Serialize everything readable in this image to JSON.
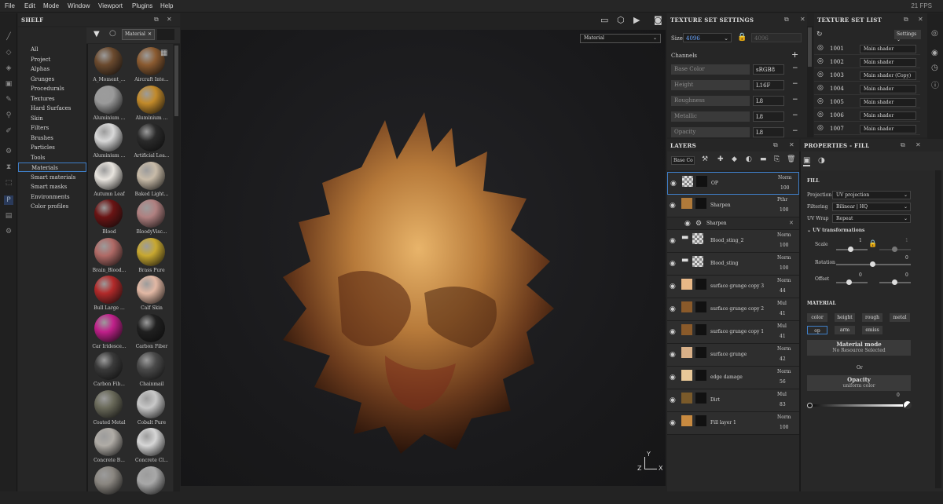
{
  "menu": {
    "file": "File",
    "edit": "Edit",
    "mode": "Mode",
    "window": "Window",
    "viewport": "Viewport",
    "plugins": "Plugins",
    "help": "Help",
    "fps": "21 FPS"
  },
  "shelf": {
    "title": "SHELF",
    "search_value": "Material",
    "categories": [
      "All",
      "Project",
      "Alphas",
      "Grunges",
      "Procedurals",
      "Textures",
      "Hard Surfaces",
      "Skin",
      "Filters",
      "Brushes",
      "Particles",
      "Tools",
      "Materials",
      "Smart materials",
      "Smart masks",
      "Environments",
      "Color profiles"
    ],
    "items": [
      {
        "label": "A_Moment_...",
        "color": "#6b4a2e"
      },
      {
        "label": "Aircraft Inte...",
        "color": "#8a5a30"
      },
      {
        "label": "Aluminium ...",
        "color": "#9a9a9a"
      },
      {
        "label": "Aluminium ...",
        "color": "#c28a2a"
      },
      {
        "label": "Aluminium ...",
        "color": "#d8d8d8"
      },
      {
        "label": "Artificial Lea...",
        "color": "#2a2a2a"
      },
      {
        "label": "Autumn Leaf",
        "color": "#e8e4de"
      },
      {
        "label": "Baked Light...",
        "color": "#c8bba8"
      },
      {
        "label": "Blood",
        "color": "#6a1414"
      },
      {
        "label": "BloodyVisc...",
        "color": "#b08080"
      },
      {
        "label": "Brain_Blood...",
        "color": "#b06a66"
      },
      {
        "label": "Brass Pure",
        "color": "#c8a830"
      },
      {
        "label": "Bull Large ...",
        "color": "#b22a2a"
      },
      {
        "label": "Calf Skin",
        "color": "#e2b8a4"
      },
      {
        "label": "Car Iridesce...",
        "color": "#c0208a"
      },
      {
        "label": "Carbon Fiber",
        "color": "#202020"
      },
      {
        "label": "Carbon Fib...",
        "color": "#3a3a3a"
      },
      {
        "label": "Chainmail",
        "color": "#4a4a4a"
      },
      {
        "label": "Coated Metal",
        "color": "#6a6a5a"
      },
      {
        "label": "Cobalt Pure",
        "color": "#c8c8c8"
      },
      {
        "label": "Concrete B...",
        "color": "#b0aca6"
      },
      {
        "label": "Concrete Cl...",
        "color": "#d6d6d6"
      },
      {
        "label": "",
        "color": "#8a8680"
      },
      {
        "label": "",
        "color": "#a8a8a8"
      }
    ]
  },
  "viewport": {
    "channel_select": "Material",
    "axis_x": "X",
    "axis_y": "Y",
    "axis_z": "Z"
  },
  "texture_set_settings": {
    "title": "TEXTURE SET SETTINGS",
    "size_label": "Size",
    "size_value": "4096",
    "size_value2": "4096",
    "channels_label": "Channels",
    "channels": [
      {
        "name": "Base Color",
        "format": "sRGB8"
      },
      {
        "name": "Height",
        "format": "L16F"
      },
      {
        "name": "Roughness",
        "format": "L8"
      },
      {
        "name": "Metallic",
        "format": "L8"
      },
      {
        "name": "Opacity",
        "format": "L8"
      }
    ]
  },
  "texture_set_list": {
    "title": "TEXTURE SET LIST",
    "settings_label": "Settings",
    "rows": [
      {
        "id": "1001",
        "shader": "Main shader"
      },
      {
        "id": "1002",
        "shader": "Main shader"
      },
      {
        "id": "1003",
        "shader": "Main shader (Copy)"
      },
      {
        "id": "1004",
        "shader": "Main shader"
      },
      {
        "id": "1005",
        "shader": "Main shader"
      },
      {
        "id": "1006",
        "shader": "Main shader"
      },
      {
        "id": "1007",
        "shader": "Main shader"
      }
    ]
  },
  "layers": {
    "title": "LAYERS",
    "channel": "Base Co",
    "rows": [
      {
        "name": "OP",
        "blend": "Norm",
        "opacity": "100",
        "thumb": "#cfcfcf"
      },
      {
        "name": "Sharpen",
        "blend": "Pthr",
        "opacity": "100",
        "thumb": "#b07a3a"
      },
      {
        "name": "Sharpen",
        "blend": "",
        "opacity": "",
        "thumb": ""
      },
      {
        "name": "Blood_sting_2",
        "blend": "Norm",
        "opacity": "100",
        "thumb": "#cfcfcf"
      },
      {
        "name": "Blood_sting",
        "blend": "Norm",
        "opacity": "100",
        "thumb": "#cfcfcf"
      },
      {
        "name": "surface grunge copy 3",
        "blend": "Norm",
        "opacity": "44",
        "thumb": "#e8b887"
      },
      {
        "name": "surface grunge copy 2",
        "blend": "Mul",
        "opacity": "41",
        "thumb": "#8a5a2a"
      },
      {
        "name": "surface grunge copy 1",
        "blend": "Mul",
        "opacity": "41",
        "thumb": "#8a5a2a"
      },
      {
        "name": "surface grunge",
        "blend": "Norm",
        "opacity": "42",
        "thumb": "#d8b088"
      },
      {
        "name": "edge damage",
        "blend": "Norm",
        "opacity": "56",
        "thumb": "#e8c898"
      },
      {
        "name": "Dirt",
        "blend": "Mul",
        "opacity": "83",
        "thumb": "#7a5a2a"
      },
      {
        "name": "Fill layer 1",
        "blend": "Norm",
        "opacity": "100",
        "thumb": "#c88a40"
      }
    ]
  },
  "properties": {
    "title": "PROPERTIES - FILL",
    "fill_label": "FILL",
    "projection_label": "Projection",
    "projection_value": "UV projection",
    "filtering_label": "Filtering",
    "filtering_value": "Bilinear | HQ",
    "uvwrap_label": "UV Wrap",
    "uvwrap_value": "Repeat",
    "uvtrans_label": "UV transformations",
    "scale_label": "Scale",
    "scale_value": "1",
    "scale_value2": "1",
    "rotation_label": "Rotation",
    "rotation_value": "0",
    "offset_label": "Offset",
    "offset_value": "0",
    "offset_value2": "0",
    "material_label": "MATERIAL",
    "chan_buttons": [
      "color",
      "height",
      "rough",
      "metal",
      "op",
      "arm",
      "emiss"
    ],
    "material_mode_label": "Material mode",
    "material_mode_sub": "No Resource Selected",
    "or_label": "Or",
    "opacity_label": "Opacity",
    "opacity_sub": "uniform color",
    "opacity_value": "0"
  }
}
